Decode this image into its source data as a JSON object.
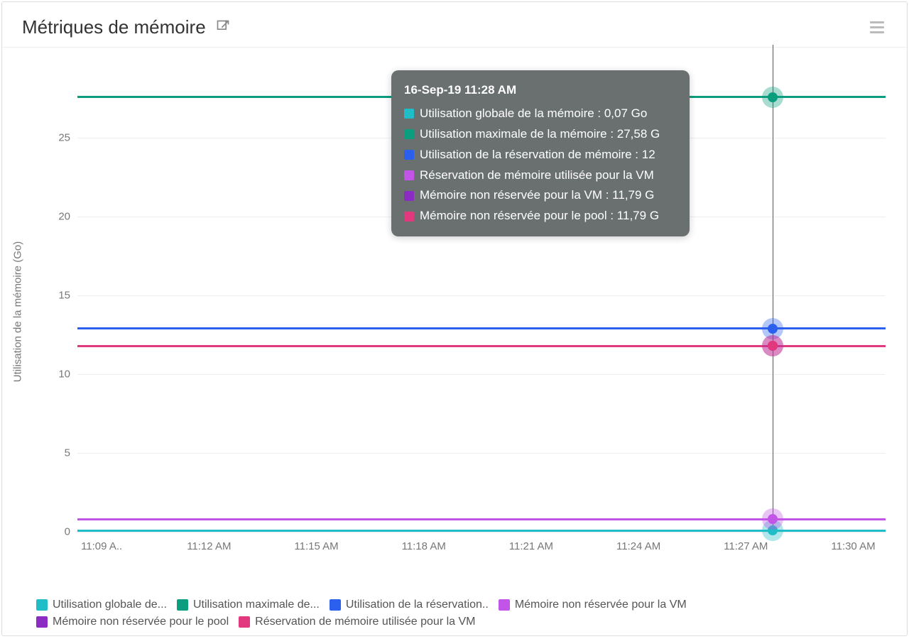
{
  "header": {
    "title": "Métriques de mémoire"
  },
  "chart_data": {
    "type": "line",
    "title": "Métriques de mémoire",
    "ylabel": "Utilisation de la mémoire (Go)",
    "xlabel": "",
    "ylim": [
      0,
      30
    ],
    "y_ticks": [
      0,
      5,
      10,
      15,
      20,
      25
    ],
    "x_ticks": [
      "11:09 A..",
      "11:12 AM",
      "11:15 AM",
      "11:18 AM",
      "11:21 AM",
      "11:24 AM",
      "11:27 AM",
      "11:30 AM"
    ],
    "categories": [
      "11:09 AM",
      "11:12 AM",
      "11:15 AM",
      "11:18 AM",
      "11:21 AM",
      "11:24 AM",
      "11:27 AM",
      "11:28 AM",
      "11:30 AM"
    ],
    "series": [
      {
        "name": "Utilisation globale de la mémoire",
        "color": "#1fbdc7",
        "values": [
          0.07,
          0.07,
          0.07,
          0.07,
          0.07,
          0.07,
          0.07,
          0.07,
          0.07
        ]
      },
      {
        "name": "Utilisation maximale de la mémoire",
        "color": "#0a9e7e",
        "values": [
          27.58,
          27.58,
          27.58,
          27.58,
          27.58,
          27.58,
          27.58,
          27.58,
          27.58
        ]
      },
      {
        "name": "Utilisation de la réservation de mémoire",
        "color": "#2b60ef",
        "values": [
          12.9,
          12.9,
          12.9,
          12.9,
          12.9,
          12.9,
          12.9,
          12.9,
          12.9
        ]
      },
      {
        "name": "Réservation de mémoire utilisée pour la VM",
        "color": "#c254e8",
        "values": [
          0.8,
          0.8,
          0.8,
          0.8,
          0.8,
          0.8,
          0.8,
          0.8,
          0.8
        ]
      },
      {
        "name": "Mémoire non réservée pour la VM",
        "color": "#8b2dc2",
        "values": [
          11.79,
          11.79,
          11.79,
          11.79,
          11.79,
          11.79,
          11.79,
          11.79,
          11.79
        ]
      },
      {
        "name": "Mémoire non réservée pour le pool",
        "color": "#e2387e",
        "values": [
          11.79,
          11.79,
          11.79,
          11.79,
          11.79,
          11.79,
          11.79,
          11.79,
          11.79
        ]
      }
    ],
    "hover": {
      "timestamp": "16-Sep-19 11:28 AM",
      "rows": [
        {
          "color": "#1fbdc7",
          "text": "Utilisation globale de la mémoire : 0,07 Go"
        },
        {
          "color": "#0a9e7e",
          "text": "Utilisation maximale de la mémoire : 27,58 G"
        },
        {
          "color": "#2b60ef",
          "text": "Utilisation de la réservation de mémoire : 12"
        },
        {
          "color": "#c254e8",
          "text": "Réservation de mémoire utilisée pour la VM"
        },
        {
          "color": "#8b2dc2",
          "text": "Mémoire non réservée pour la VM : 11,79 G"
        },
        {
          "color": "#e2387e",
          "text": "Mémoire non réservée pour le pool : 11,79 G"
        }
      ]
    }
  },
  "legend": [
    {
      "color": "#1fbdc7",
      "label": "Utilisation globale de..."
    },
    {
      "color": "#0a9e7e",
      "label": "Utilisation maximale de..."
    },
    {
      "color": "#2b60ef",
      "label": "Utilisation de la réservation.."
    },
    {
      "color": "#c254e8",
      "label": "Mémoire non réservée pour la VM"
    },
    {
      "color": "#8b2dc2",
      "label": "Mémoire non réservée pour le pool"
    },
    {
      "color": "#e2387e",
      "label": "Réservation de mémoire utilisée pour la VM"
    }
  ]
}
